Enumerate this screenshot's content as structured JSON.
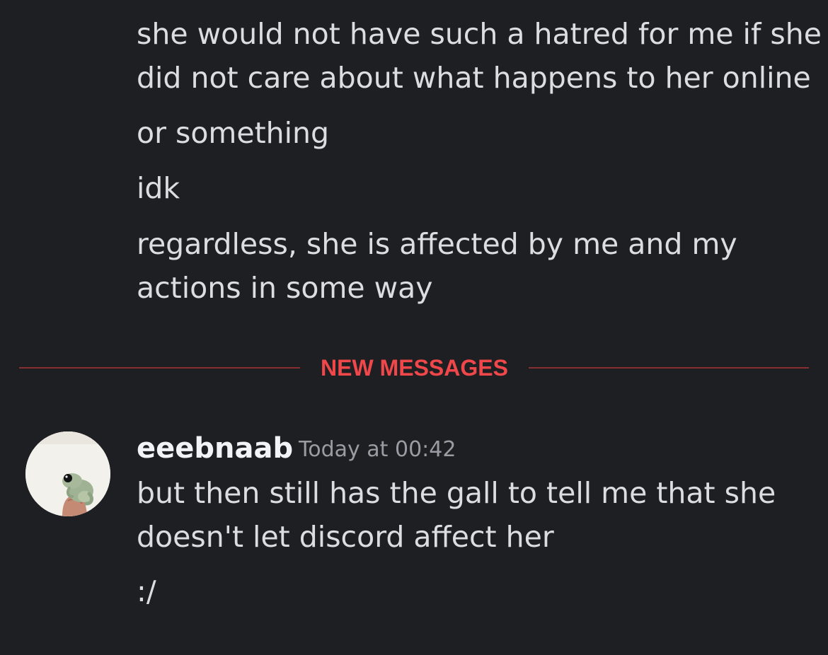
{
  "earlier_messages": [
    {
      "lines": [
        "she would not have such a hatred for me if she",
        "did not care about what happens to her online"
      ]
    },
    {
      "lines": [
        "or something"
      ]
    },
    {
      "lines": [
        "idk"
      ]
    },
    {
      "lines": [
        "regardless, she is affected by me and my",
        "actions in some way"
      ]
    }
  ],
  "new_messages_divider": {
    "label": "NEW MESSAGES",
    "color": "#f0474a"
  },
  "latest_group": {
    "username": "eeebnaab",
    "timestamp": "Today at 00:42",
    "avatar_icon": "frog-avatar-icon",
    "messages": [
      {
        "lines": [
          "but then still has the gall to tell me that she",
          "doesn't let discord affect her"
        ]
      },
      {
        "lines": [
          ":/"
        ]
      }
    ]
  },
  "colors": {
    "background": "#1e1f22",
    "text": "#dbdee1",
    "username": "#f2f3f5",
    "timestamp": "#9a9ca3"
  }
}
